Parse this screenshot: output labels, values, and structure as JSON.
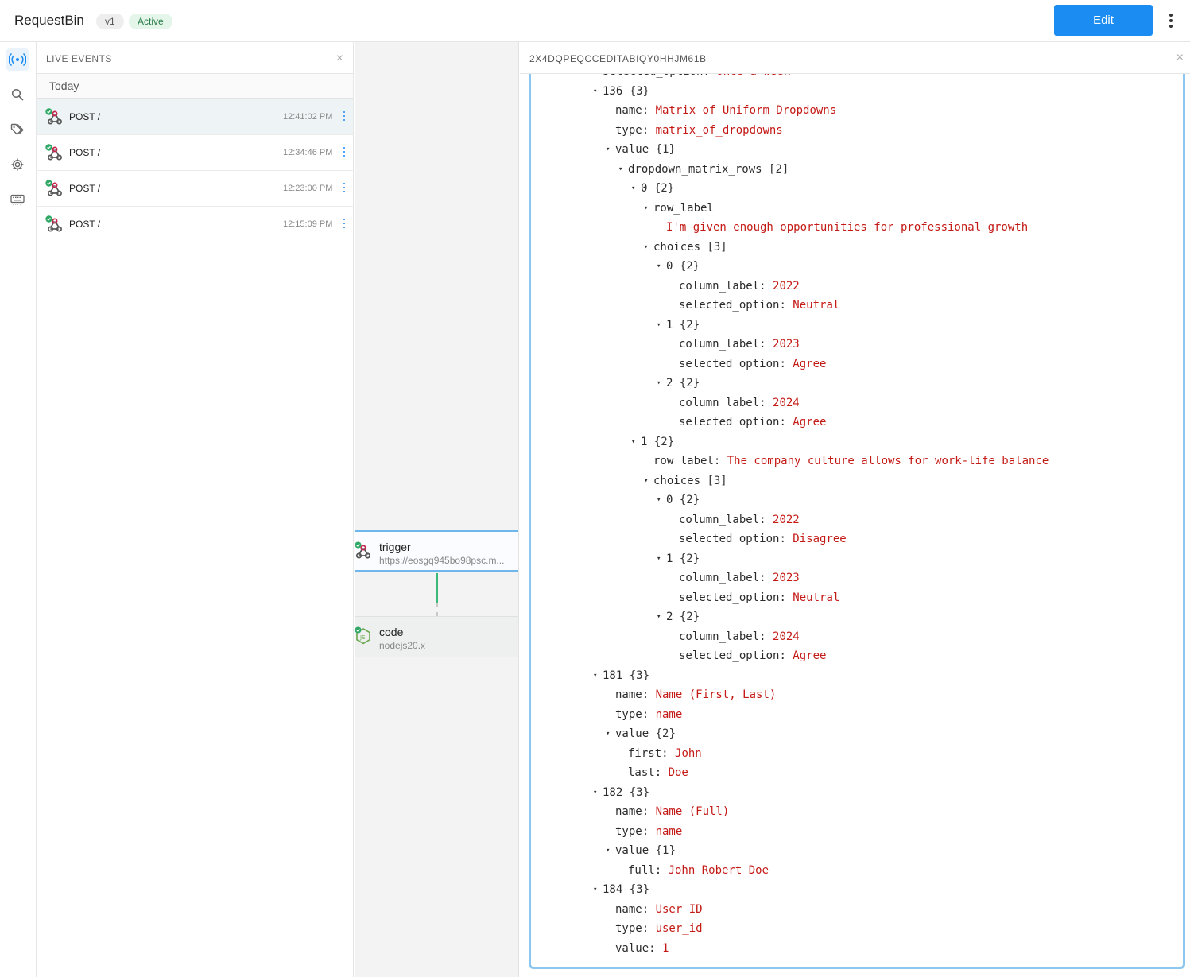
{
  "header": {
    "app_title": "RequestBin",
    "version_badge": "v1",
    "status_badge": "Active",
    "edit_label": "Edit",
    "accent_color": "#1b8cf2"
  },
  "rail": {
    "items": [
      {
        "icon": "live-broadcast-icon",
        "active": true
      },
      {
        "icon": "search-icon",
        "active": false
      },
      {
        "icon": "tag-icon",
        "active": false
      },
      {
        "icon": "gear-icon",
        "active": false
      },
      {
        "icon": "keyboard-icon",
        "active": false
      }
    ]
  },
  "events": {
    "title": "LIVE EVENTS",
    "close_glyph": "×",
    "group_label": "Today",
    "items": [
      {
        "method": "POST /",
        "time": "12:41:02 PM",
        "selected": true
      },
      {
        "method": "POST /",
        "time": "12:34:46 PM",
        "selected": false
      },
      {
        "method": "POST /",
        "time": "12:23:00 PM",
        "selected": false
      },
      {
        "method": "POST /",
        "time": "12:15:09 PM",
        "selected": false
      }
    ]
  },
  "canvas": {
    "trigger": {
      "title": "trigger",
      "subtitle": "https://eosgq945bo98psc.m..."
    },
    "code": {
      "title": "code",
      "subtitle": "nodejs20.x"
    }
  },
  "inspector": {
    "event_id": "2X4DQPEQCCEDITABIQY0HHJM61B",
    "close_glyph": "×",
    "json_lines": [
      {
        "indent": 5,
        "toggle": false,
        "key": "selected_option",
        "value": "Once a week",
        "meta": "",
        "clipped": true
      },
      {
        "indent": 5,
        "toggle": true,
        "key": "136",
        "value": "",
        "meta": "{3}"
      },
      {
        "indent": 6,
        "toggle": false,
        "key": "name",
        "value": "Matrix of Uniform Dropdowns",
        "meta": ""
      },
      {
        "indent": 6,
        "toggle": false,
        "key": "type",
        "value": "matrix_of_dropdowns",
        "meta": ""
      },
      {
        "indent": 6,
        "toggle": true,
        "key": "value",
        "value": "",
        "meta": "{1}"
      },
      {
        "indent": 7,
        "toggle": true,
        "key": "dropdown_matrix_rows",
        "value": "",
        "meta": "[2]"
      },
      {
        "indent": 8,
        "toggle": true,
        "key": "0",
        "value": "",
        "meta": "{2}"
      },
      {
        "indent": 9,
        "toggle": true,
        "key": "row_label",
        "value": "",
        "meta": ""
      },
      {
        "indent": 10,
        "toggle": false,
        "key": "",
        "value": "I'm given enough opportunities for professional growth",
        "meta": ""
      },
      {
        "indent": 9,
        "toggle": true,
        "key": "choices",
        "value": "",
        "meta": "[3]"
      },
      {
        "indent": 10,
        "toggle": true,
        "key": "0",
        "value": "",
        "meta": "{2}"
      },
      {
        "indent": 11,
        "toggle": false,
        "key": "column_label",
        "value": "2022",
        "meta": ""
      },
      {
        "indent": 11,
        "toggle": false,
        "key": "selected_option",
        "value": "Neutral",
        "meta": ""
      },
      {
        "indent": 10,
        "toggle": true,
        "key": "1",
        "value": "",
        "meta": "{2}"
      },
      {
        "indent": 11,
        "toggle": false,
        "key": "column_label",
        "value": "2023",
        "meta": ""
      },
      {
        "indent": 11,
        "toggle": false,
        "key": "selected_option",
        "value": "Agree",
        "meta": ""
      },
      {
        "indent": 10,
        "toggle": true,
        "key": "2",
        "value": "",
        "meta": "{2}"
      },
      {
        "indent": 11,
        "toggle": false,
        "key": "column_label",
        "value": "2024",
        "meta": ""
      },
      {
        "indent": 11,
        "toggle": false,
        "key": "selected_option",
        "value": "Agree",
        "meta": ""
      },
      {
        "indent": 8,
        "toggle": true,
        "key": "1",
        "value": "",
        "meta": "{2}"
      },
      {
        "indent": 9,
        "toggle": false,
        "key": "row_label",
        "value": "The company culture allows for work-life balance",
        "meta": ""
      },
      {
        "indent": 9,
        "toggle": true,
        "key": "choices",
        "value": "",
        "meta": "[3]"
      },
      {
        "indent": 10,
        "toggle": true,
        "key": "0",
        "value": "",
        "meta": "{2}"
      },
      {
        "indent": 11,
        "toggle": false,
        "key": "column_label",
        "value": "2022",
        "meta": ""
      },
      {
        "indent": 11,
        "toggle": false,
        "key": "selected_option",
        "value": "Disagree",
        "meta": ""
      },
      {
        "indent": 10,
        "toggle": true,
        "key": "1",
        "value": "",
        "meta": "{2}"
      },
      {
        "indent": 11,
        "toggle": false,
        "key": "column_label",
        "value": "2023",
        "meta": ""
      },
      {
        "indent": 11,
        "toggle": false,
        "key": "selected_option",
        "value": "Neutral",
        "meta": ""
      },
      {
        "indent": 10,
        "toggle": true,
        "key": "2",
        "value": "",
        "meta": "{2}"
      },
      {
        "indent": 11,
        "toggle": false,
        "key": "column_label",
        "value": "2024",
        "meta": ""
      },
      {
        "indent": 11,
        "toggle": false,
        "key": "selected_option",
        "value": "Agree",
        "meta": ""
      },
      {
        "indent": 5,
        "toggle": true,
        "key": "181",
        "value": "",
        "meta": "{3}"
      },
      {
        "indent": 6,
        "toggle": false,
        "key": "name",
        "value": "Name (First, Last)",
        "meta": ""
      },
      {
        "indent": 6,
        "toggle": false,
        "key": "type",
        "value": "name",
        "meta": ""
      },
      {
        "indent": 6,
        "toggle": true,
        "key": "value",
        "value": "",
        "meta": "{2}"
      },
      {
        "indent": 7,
        "toggle": false,
        "key": "first",
        "value": "John",
        "meta": ""
      },
      {
        "indent": 7,
        "toggle": false,
        "key": "last",
        "value": "Doe",
        "meta": ""
      },
      {
        "indent": 5,
        "toggle": true,
        "key": "182",
        "value": "",
        "meta": "{3}"
      },
      {
        "indent": 6,
        "toggle": false,
        "key": "name",
        "value": "Name (Full)",
        "meta": ""
      },
      {
        "indent": 6,
        "toggle": false,
        "key": "type",
        "value": "name",
        "meta": ""
      },
      {
        "indent": 6,
        "toggle": true,
        "key": "value",
        "value": "",
        "meta": "{1}"
      },
      {
        "indent": 7,
        "toggle": false,
        "key": "full",
        "value": "John Robert Doe",
        "meta": ""
      },
      {
        "indent": 5,
        "toggle": true,
        "key": "184",
        "value": "",
        "meta": "{3}"
      },
      {
        "indent": 6,
        "toggle": false,
        "key": "name",
        "value": "User ID",
        "meta": ""
      },
      {
        "indent": 6,
        "toggle": false,
        "key": "type",
        "value": "user_id",
        "meta": ""
      },
      {
        "indent": 6,
        "toggle": false,
        "key": "value",
        "value": "1",
        "meta": ""
      }
    ]
  }
}
